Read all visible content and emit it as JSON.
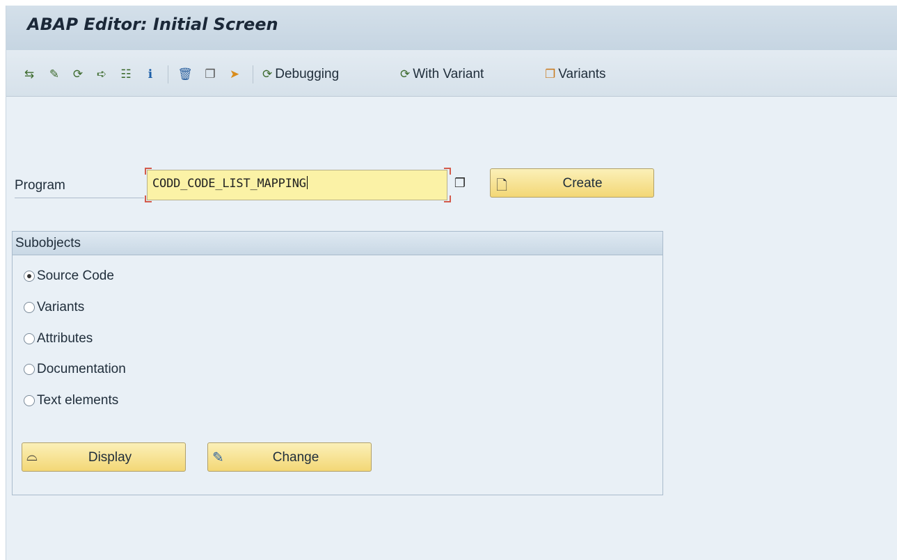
{
  "window": {
    "title": "ABAP Editor: Initial Screen"
  },
  "toolbar": {
    "icons": [
      {
        "name": "other-object-icon",
        "glyph": "⇆"
      },
      {
        "name": "wizard-icon",
        "glyph": "✎"
      },
      {
        "name": "execute-icon",
        "glyph": "⟳"
      },
      {
        "name": "where-used-icon",
        "glyph": "➪"
      },
      {
        "name": "object-list-icon",
        "glyph": "☷"
      },
      {
        "name": "info-icon",
        "glyph": "ℹ"
      },
      {
        "name": "delete-icon",
        "glyph": "🗑"
      },
      {
        "name": "copy-icon",
        "glyph": "❐"
      },
      {
        "name": "rename-icon",
        "glyph": "➤"
      }
    ],
    "debugging_label": "Debugging",
    "with_variant_label": "With Variant",
    "variants_label": "Variants"
  },
  "program": {
    "label": "Program",
    "value": "CODD_CODE_LIST_MAPPING",
    "create_label": "Create"
  },
  "subobjects": {
    "title": "Subobjects",
    "options": [
      {
        "label": "Source Code",
        "checked": true
      },
      {
        "label": "Variants",
        "checked": false
      },
      {
        "label": "Attributes",
        "checked": false
      },
      {
        "label": "Documentation",
        "checked": false
      },
      {
        "label": "Text elements",
        "checked": false
      }
    ],
    "display_label": "Display",
    "change_label": "Change"
  },
  "colors": {
    "input_bg": "#fbf2a6",
    "button_bg": "#f3d776",
    "frame_bg": "#e9f0f6"
  }
}
